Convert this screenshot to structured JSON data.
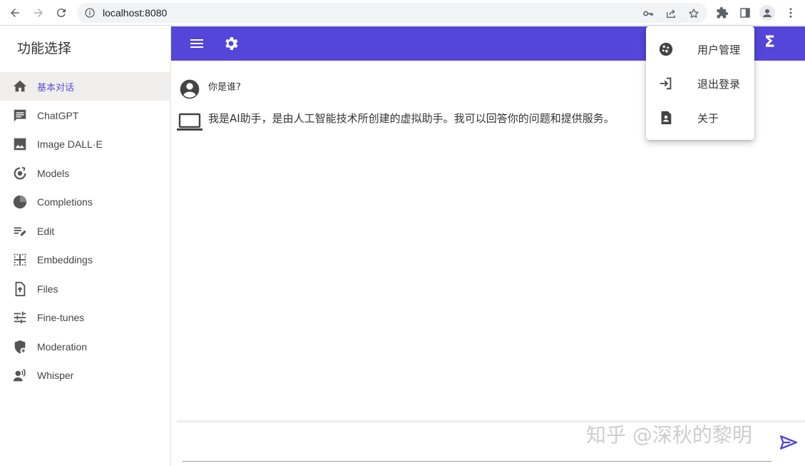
{
  "browser": {
    "url": "localhost:8080",
    "colors": {
      "icon": "#5f6368",
      "forward_disabled": "#b0b0b0"
    }
  },
  "sidebar": {
    "title": "功能选择",
    "items": [
      {
        "label": "基本对话",
        "icon": "home-icon",
        "active": true
      },
      {
        "label": "ChatGPT",
        "icon": "chat-icon"
      },
      {
        "label": "Image DALL·E",
        "icon": "image-icon"
      },
      {
        "label": "Models",
        "icon": "models-icon"
      },
      {
        "label": "Completions",
        "icon": "pie-chart-icon"
      },
      {
        "label": "Edit",
        "icon": "edit-note-icon"
      },
      {
        "label": "Embeddings",
        "icon": "grid-dots-icon"
      },
      {
        "label": "Files",
        "icon": "file-upload-icon"
      },
      {
        "label": "Fine-tunes",
        "icon": "tune-icon"
      },
      {
        "label": "Moderation",
        "icon": "shield-add-icon"
      },
      {
        "label": "Whisper",
        "icon": "voice-person-icon"
      }
    ]
  },
  "appbar": {
    "color": "#5446d8",
    "sigma_symbol": "Σ"
  },
  "messages": [
    {
      "role": "user",
      "icon": "account-circle-icon",
      "text": "你是谁?"
    },
    {
      "role": "assistant",
      "icon": "laptop-icon",
      "text": "我是AI助手，是由人工智能技术所创建的虚拟助手。我可以回答你的问题和提供服务。"
    }
  ],
  "menu": {
    "items": [
      {
        "label": "用户管理",
        "icon": "cookie-icon"
      },
      {
        "label": "退出登录",
        "icon": "login-icon"
      },
      {
        "label": "关于",
        "icon": "contact-page-icon"
      }
    ]
  },
  "input": {
    "placeholder": "",
    "value": ""
  },
  "watermark": "知乎 @深秋的黎明",
  "send": {
    "icon": "send-icon",
    "color": "#5446d8"
  }
}
